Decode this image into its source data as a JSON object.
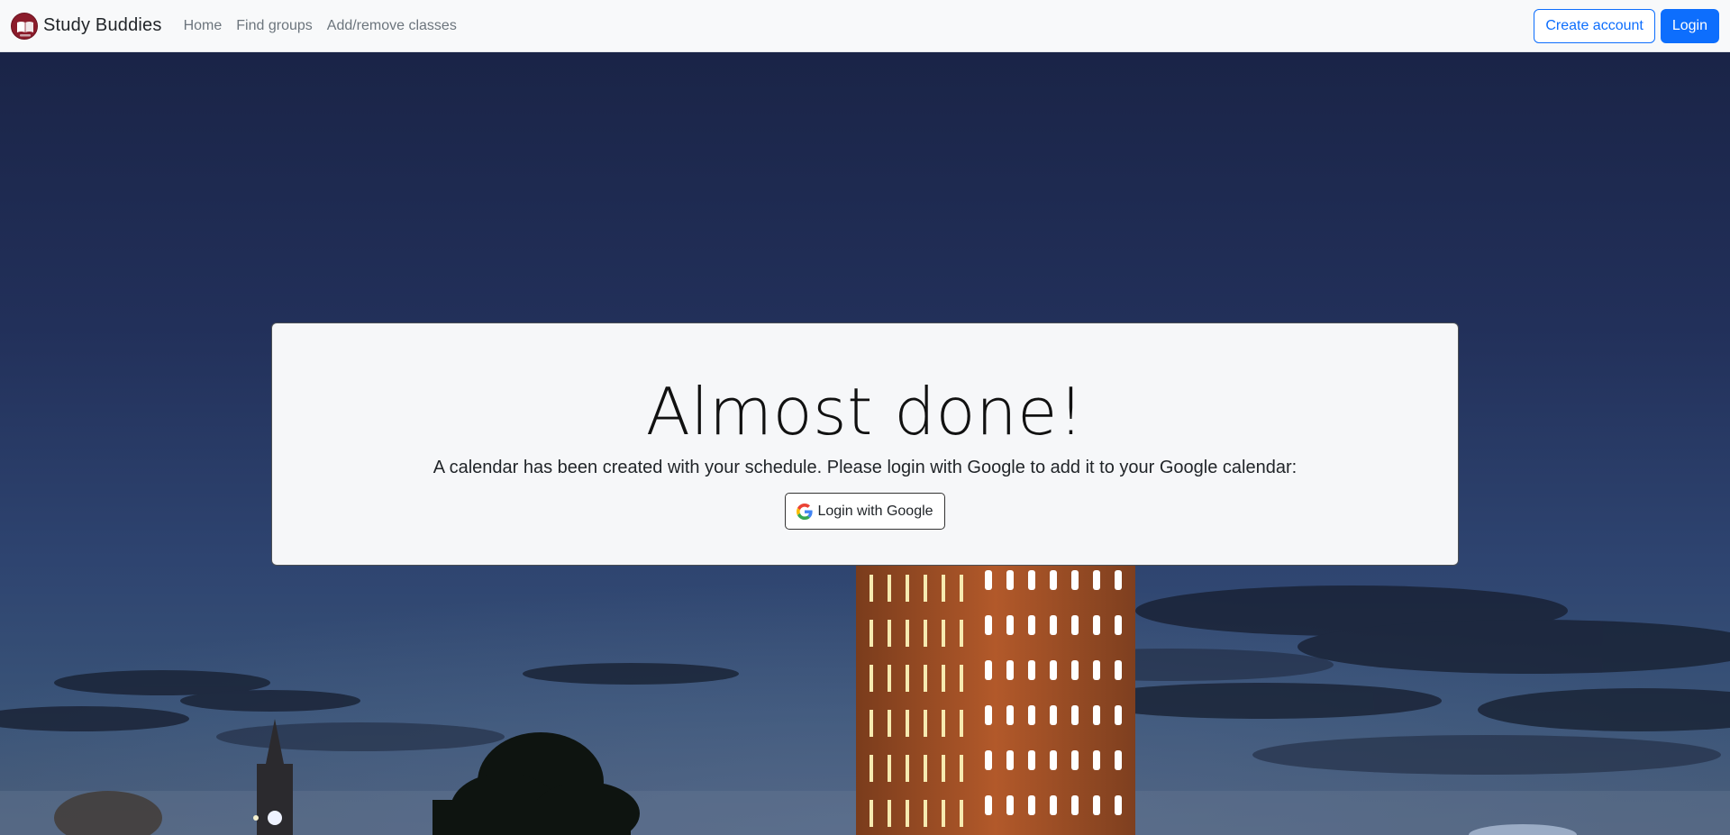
{
  "navbar": {
    "brand": "Study Buddies",
    "links": [
      "Home",
      "Find groups",
      "Add/remove classes"
    ],
    "create_account": "Create account",
    "login": "Login"
  },
  "card": {
    "title": "Almost done!",
    "message": "A calendar has been created with your schedule. Please login with Google to add it to your Google calendar:",
    "google_button": "Login with Google"
  },
  "icons": {
    "brand_logo": "book-logo-icon",
    "google": "google-g-icon"
  },
  "colors": {
    "primary": "#0d6efd",
    "brand_logo": "#8b1c2b",
    "navbar_bg": "#f8f9fa",
    "card_bg": "#f6f7f9",
    "sky_top": "#1a2447",
    "sky_bottom": "#3a5478"
  }
}
